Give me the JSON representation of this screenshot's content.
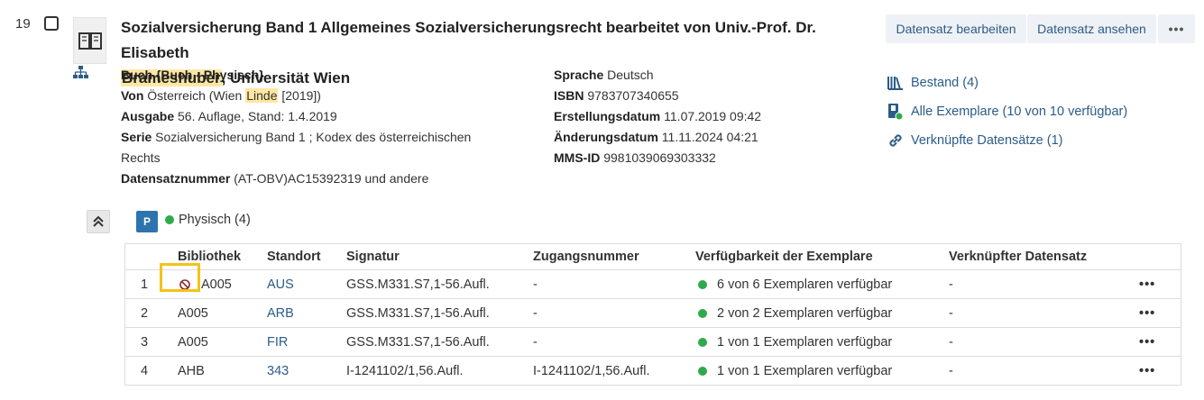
{
  "record": {
    "index": "19",
    "title_part1": "Sozialversicherung Band 1 Allgemeines Sozialversicherungsrecht bearbeitet von Univ.-Prof. Dr. Elisabeth",
    "title_highlight": "Brameshuber",
    "title_part2": ", Universität Wien",
    "buttons": {
      "edit": "Datensatz bearbeiten",
      "view": "Datensatz ansehen",
      "more": "•••"
    },
    "left_fields": {
      "type": "Buch {Buch - Physisch}",
      "von_label": "Von",
      "von_value_pre": "Österreich (Wien ",
      "von_value_hl": "Linde",
      "von_value_post": " [2019])",
      "ausgabe_label": "Ausgabe",
      "ausgabe_value": "56. Auflage, Stand: 1.4.2019",
      "serie_label": "Serie",
      "serie_value": "Sozialversicherung Band 1 ; Kodex des österreichischen Rechts",
      "dsn_label": "Datensatznummer",
      "dsn_value": "(AT-OBV)AC15392319 und andere"
    },
    "right_fields": {
      "sprache_label": "Sprache",
      "sprache_value": "Deutsch",
      "isbn_label": "ISBN",
      "isbn_value": "9783707340655",
      "erst_label": "Erstellungsdatum",
      "erst_value": "11.07.2019 09:42",
      "aend_label": "Änderungsdatum",
      "aend_value": "11.11.2024 04:21",
      "mms_label": "MMS-ID",
      "mms_value": "9981039069303332"
    },
    "links": {
      "bestand": "Bestand (4)",
      "exemplare": "Alle Exemplare (10 von 10 verfügbar)",
      "verknuepft": "Verknüpfte Datensätze (1)"
    }
  },
  "holdings": {
    "badge": "P",
    "label": "Physisch (4)",
    "columns": [
      "",
      "Bibliothek",
      "Standort",
      "Signatur",
      "Zugangsnummer",
      "Verfügbarkeit der Exemplare",
      "Verknüpfter Datensatz"
    ],
    "rows": [
      {
        "n": "1",
        "bib": "A005",
        "sto": "AUS",
        "sig": "GSS.M331.S7,1-56.Aufl.",
        "zug": "-",
        "ver": "6 von 6 Exemplaren verfügbar",
        "lnk": "-",
        "act": "•••"
      },
      {
        "n": "2",
        "bib": "A005",
        "sto": "ARB",
        "sig": "GSS.M331.S7,1-56.Aufl.",
        "zug": "-",
        "ver": "2 von 2 Exemplaren verfügbar",
        "lnk": "-",
        "act": "•••"
      },
      {
        "n": "3",
        "bib": "A005",
        "sto": "FIR",
        "sig": "GSS.M331.S7,1-56.Aufl.",
        "zug": "-",
        "ver": "1 von 1 Exemplaren verfügbar",
        "lnk": "-",
        "act": "•••"
      },
      {
        "n": "4",
        "bib": "AHB",
        "sto": "343",
        "sig": "I-1241102/1,56.Aufl.",
        "zug": "I-1241102/1,56.Aufl.",
        "ver": "1 von 1 Exemplaren verfügbar",
        "lnk": "-",
        "act": "•••"
      }
    ]
  },
  "colors": {
    "link": "#2b5c8a",
    "available": "#2eaa4a",
    "highlight": "#fde7a3",
    "focus": "#f2c318",
    "badge": "#2d73b0"
  }
}
